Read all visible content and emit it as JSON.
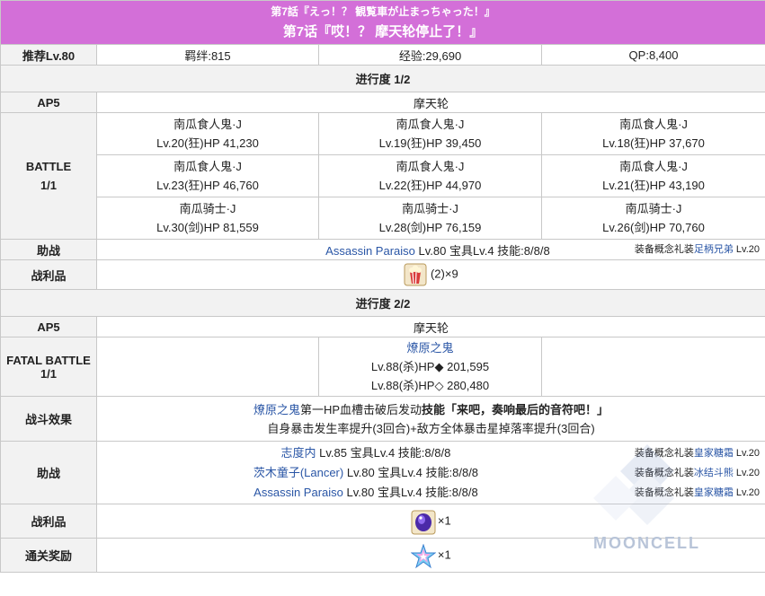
{
  "header": {
    "title_jp": "第7話『えっ！？ 観覧車が止まっちゃった！』",
    "title_cn": "第7话『哎！？ 摩天轮停止了！』"
  },
  "summary": {
    "recommended_label": "推荐Lv.80",
    "bond": "羁绊:815",
    "exp": "经验:29,690",
    "qp": "QP:8,400"
  },
  "progress1": {
    "title": "进行度 1/2",
    "ap_label": "AP5",
    "location": "摩天轮",
    "battle_label_1": "BATTLE",
    "battle_label_2": "1/1",
    "enemies": [
      {
        "name": "南瓜食人鬼·J",
        "stats": "Lv.20(狂)HP 41,230"
      },
      {
        "name": "南瓜食人鬼·J",
        "stats": "Lv.19(狂)HP 39,450"
      },
      {
        "name": "南瓜食人鬼·J",
        "stats": "Lv.18(狂)HP 37,670"
      },
      {
        "name": "南瓜食人鬼·J",
        "stats": "Lv.23(狂)HP 46,760"
      },
      {
        "name": "南瓜食人鬼·J",
        "stats": "Lv.22(狂)HP 44,970"
      },
      {
        "name": "南瓜食人鬼·J",
        "stats": "Lv.21(狂)HP 43,190"
      },
      {
        "name": "南瓜骑士·J",
        "stats": "Lv.30(剑)HP 81,559"
      },
      {
        "name": "南瓜骑士·J",
        "stats": "Lv.28(剑)HP 76,159"
      },
      {
        "name": "南瓜骑士·J",
        "stats": "Lv.26(剑)HP 70,760"
      }
    ],
    "support_label": "助战",
    "support_name": "Assassin Paraiso",
    "support_info": " Lv.80 宝具Lv.4 技能:8/8/8",
    "support_ce_prefix": "装备概念礼装",
    "support_ce_name": "足柄兄弟",
    "support_ce_lv": " Lv.20",
    "drops_label": "战利品",
    "drop_text": "(2)×9"
  },
  "progress2": {
    "title": "进行度 2/2",
    "ap_label": "AP5",
    "location": "摩天轮",
    "battle_label_1": "FATAL BATTLE",
    "battle_label_2": "1/1",
    "boss_name": "燎原之鬼",
    "boss_hp1": "Lv.88(杀)HP◆ 201,595",
    "boss_hp2": "Lv.88(杀)HP◇ 280,480",
    "effect_label": "战斗效果",
    "effect_name": "燎原之鬼",
    "effect_mid": "第一HP血槽击破后发动",
    "effect_skill": "技能「来吧，奏响最后的音符吧！」",
    "effect_line2": "自身暴击发生率提升(3回合)+敌方全体暴击星掉落率提升(3回合)",
    "support_label": "助战",
    "supports": [
      {
        "name": "志度内",
        "info": " Lv.85 宝具Lv.4 技能:8/8/8",
        "ce": "皇家糖霜",
        "ce_lv": " Lv.20"
      },
      {
        "name": "茨木童子(Lancer)",
        "info": " Lv.80 宝具Lv.4 技能:8/8/8",
        "ce": "冰结斗熊",
        "ce_lv": " Lv.20"
      },
      {
        "name": "Assassin Paraiso",
        "info": " Lv.80 宝具Lv.4 技能:8/8/8",
        "ce": "皇家糖霜",
        "ce_lv": " Lv.20"
      }
    ],
    "ce_prefix": "装备概念礼装",
    "drops_label": "战利品",
    "drop_text": "×1",
    "clear_label": "通关奖励",
    "clear_text": "×1"
  },
  "watermark": "MOONCELL"
}
